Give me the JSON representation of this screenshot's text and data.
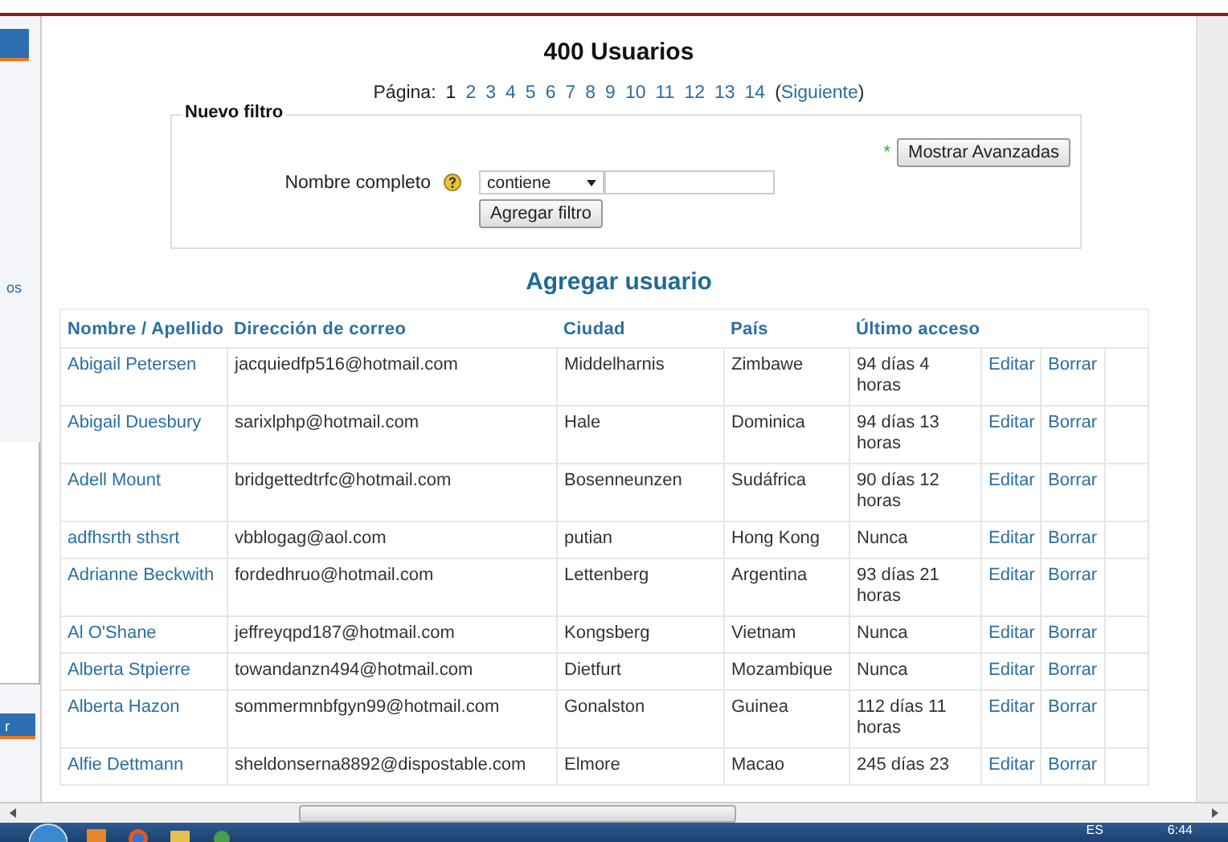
{
  "background_windows": {
    "fragments": [
      "os",
      "r"
    ]
  },
  "title": "400 Usuarios",
  "pagination": {
    "label": "Página:",
    "pages": [
      {
        "label": "1",
        "selected": true
      },
      {
        "label": "2",
        "selected": false
      },
      {
        "label": "3",
        "selected": false
      },
      {
        "label": "4",
        "selected": false
      },
      {
        "label": "5",
        "selected": false
      },
      {
        "label": "6",
        "selected": false
      },
      {
        "label": "7",
        "selected": false
      },
      {
        "label": "8",
        "selected": false
      },
      {
        "label": "9",
        "selected": false
      },
      {
        "label": "10",
        "selected": false
      },
      {
        "label": "11",
        "selected": false
      },
      {
        "label": "12",
        "selected": false
      },
      {
        "label": "13",
        "selected": false
      },
      {
        "label": "14",
        "selected": false
      }
    ],
    "next": {
      "before": "(",
      "label": "Siguiente",
      "after": ")"
    }
  },
  "filter": {
    "legend": "Nuevo filtro",
    "required_mark": "*",
    "advanced_button": "Mostrar Avanzadas",
    "field_label": "Nombre completo",
    "operator": "contiene",
    "add_button": "Agregar filtro"
  },
  "add_user": "Agregar usuario",
  "table": {
    "columns": [
      "Nombre / Apellido",
      "Dirección de correo",
      "Ciudad",
      "País",
      "Último acceso"
    ],
    "rows": [
      {
        "name": "Abigail Petersen",
        "email": "jacquiedfp516@hotmail.com",
        "city": "Middelharnis",
        "country": "Zimbawe",
        "last_access": "94 días 4 horas",
        "edit": "Editar",
        "delete": "Borrar"
      },
      {
        "name": "Abigail Duesbury",
        "email": "sarixlphp@hotmail.com",
        "city": "Hale",
        "country": "Dominica",
        "last_access": "94 días 13 horas",
        "edit": "Editar",
        "delete": "Borrar"
      },
      {
        "name": "Adell Mount",
        "email": "bridgettedtrfc@hotmail.com",
        "city": "Bosenneunzen",
        "country": "Sudáfrica",
        "last_access": "90 días 12 horas",
        "edit": "Editar",
        "delete": "Borrar"
      },
      {
        "name": "adfhsrth sthsrt",
        "email": "vbblogag@aol.com",
        "city": "putian",
        "country": "Hong Kong",
        "last_access": "Nunca",
        "edit": "Editar",
        "delete": "Borrar"
      },
      {
        "name": "Adrianne Beckwith",
        "email": "fordedhruo@hotmail.com",
        "city": "Lettenberg",
        "country": "Argentina",
        "last_access": "93 días 21 horas",
        "edit": "Editar",
        "delete": "Borrar"
      },
      {
        "name": "Al O'Shane",
        "email": "jeffreyqpd187@hotmail.com",
        "city": "Kongsberg",
        "country": "Vietnam",
        "last_access": "Nunca",
        "edit": "Editar",
        "delete": "Borrar"
      },
      {
        "name": "Alberta Stpierre",
        "email": "towandanzn494@hotmail.com",
        "city": "Dietfurt",
        "country": "Mozambique",
        "last_access": "Nunca",
        "edit": "Editar",
        "delete": "Borrar"
      },
      {
        "name": "Alberta Hazon",
        "email": "sommermnbfgyn99@hotmail.com",
        "city": "Gonalston",
        "country": "Guinea",
        "last_access": "112 días 11 horas",
        "edit": "Editar",
        "delete": "Borrar"
      },
      {
        "name": "Alfie Dettmann",
        "email": "sheldonserna8892@dispostable.com",
        "city": "Elmore",
        "country": "Macao",
        "last_access": "245 días 23",
        "edit": "Editar",
        "delete": "Borrar"
      }
    ]
  },
  "taskbar": {
    "language": "ES",
    "clock": "6:44"
  }
}
